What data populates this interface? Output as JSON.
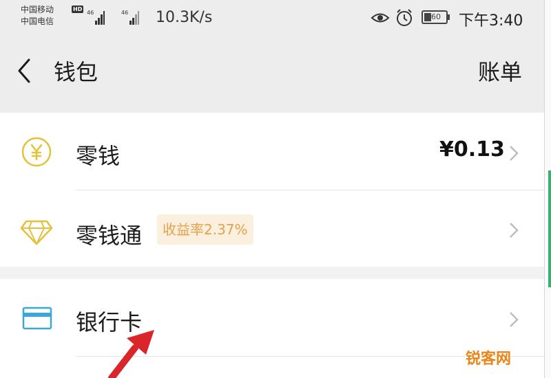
{
  "status_bar": {
    "carrier_1": "中国移动",
    "carrier_2": "中国电信",
    "hd_badge": "HD",
    "network_1": "46",
    "network_2": "46",
    "speed": "10.3K/s",
    "battery": "60",
    "time": "下午3:40"
  },
  "header": {
    "title": "钱包",
    "right_action": "账单"
  },
  "wallet_items": [
    {
      "label": "零钱",
      "icon": "yuan-coin-icon",
      "value": "¥0.13"
    },
    {
      "label": "零钱通",
      "icon": "diamond-icon",
      "badge": "收益率2.37%"
    },
    {
      "label": "银行卡",
      "icon": "bank-card-icon"
    }
  ],
  "watermark": "锐客网",
  "colors": {
    "background": "#f2f2f2",
    "card": "#ffffff",
    "icon_gold": "#e5c03a",
    "card_icon_blue": "#3aa7dc",
    "badge_bg": "#fbf0dd",
    "badge_text": "#e4a14c",
    "arrow_red": "#d9262a"
  }
}
